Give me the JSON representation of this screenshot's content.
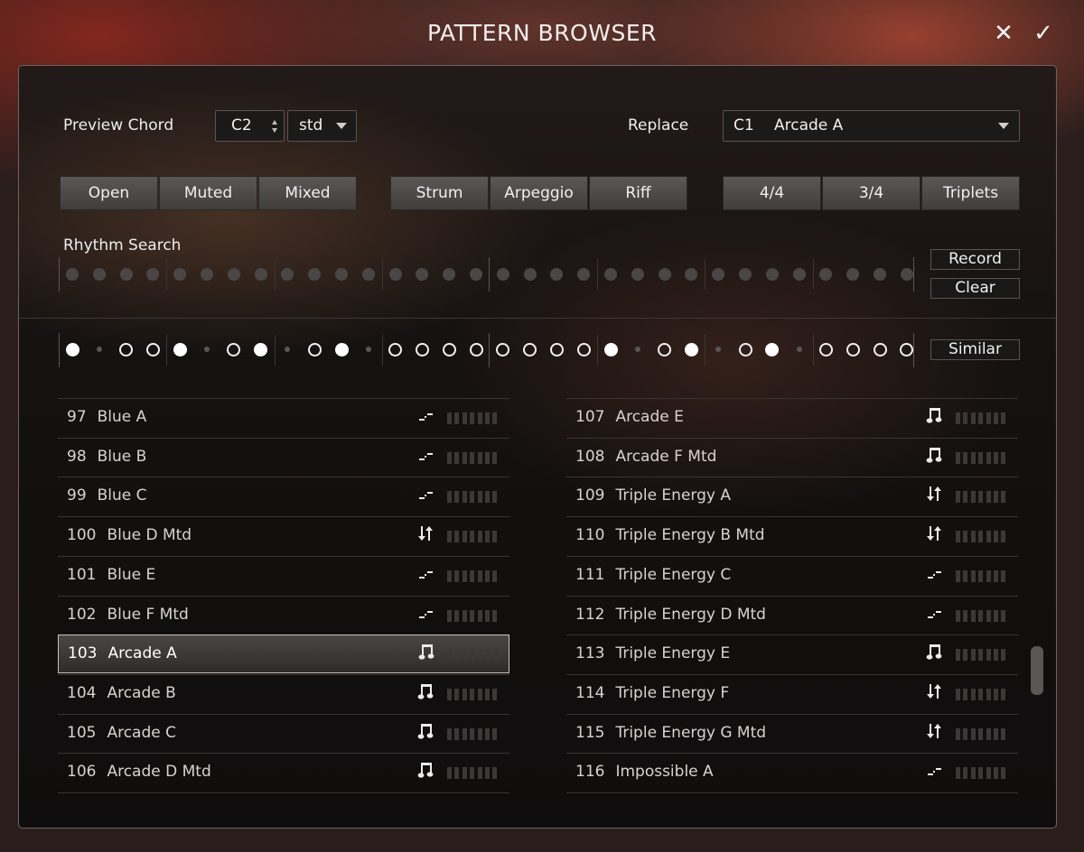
{
  "window": {
    "title": "PATTERN BROWSER",
    "close_glyph": "✕",
    "confirm_glyph": "✓"
  },
  "toolbar": {
    "preview_chord_label": "Preview Chord",
    "chord_value": "C2",
    "voicing_value": "std",
    "replace_label": "Replace",
    "replace_slot": "C1",
    "replace_value": "Arcade A",
    "style_buttons": [
      "Open",
      "Muted",
      "Mixed"
    ],
    "type_buttons": [
      "Strum",
      "Arpeggio",
      "Riff"
    ],
    "meter_buttons": [
      "4/4",
      "3/4",
      "Triplets"
    ]
  },
  "rhythm_search": {
    "label": "Rhythm Search",
    "record_label": "Record",
    "clear_label": "Clear",
    "step_count": 32
  },
  "similar": {
    "label": "Similar",
    "steps": [
      "full",
      "small",
      "open",
      "open",
      "full",
      "small",
      "open",
      "full",
      "small",
      "open",
      "full",
      "small",
      "open",
      "open",
      "open",
      "open",
      "open",
      "open",
      "open",
      "open",
      "full",
      "small",
      "open",
      "full",
      "small",
      "open",
      "full",
      "small",
      "open",
      "open",
      "open",
      "open"
    ]
  },
  "patterns_left": [
    {
      "num": "97",
      "name": "Blue A",
      "icon": "strum-icon"
    },
    {
      "num": "98",
      "name": "Blue B",
      "icon": "strum-icon"
    },
    {
      "num": "99",
      "name": "Blue C",
      "icon": "strum-icon"
    },
    {
      "num": "100",
      "name": "Blue D Mtd",
      "icon": "updown-icon"
    },
    {
      "num": "101",
      "name": "Blue E",
      "icon": "strum-icon"
    },
    {
      "num": "102",
      "name": "Blue F Mtd",
      "icon": "strum-icon"
    },
    {
      "num": "103",
      "name": "Arcade A",
      "icon": "note-icon",
      "selected": true
    },
    {
      "num": "104",
      "name": "Arcade B",
      "icon": "note-icon"
    },
    {
      "num": "105",
      "name": "Arcade C",
      "icon": "note-icon"
    },
    {
      "num": "106",
      "name": "Arcade D Mtd",
      "icon": "note-icon"
    }
  ],
  "patterns_right": [
    {
      "num": "107",
      "name": "Arcade E",
      "icon": "note-icon"
    },
    {
      "num": "108",
      "name": "Arcade F Mtd",
      "icon": "note-icon"
    },
    {
      "num": "109",
      "name": "Triple Energy A",
      "icon": "updown-icon"
    },
    {
      "num": "110",
      "name": "Triple Energy B Mtd",
      "icon": "updown-icon"
    },
    {
      "num": "111",
      "name": "Triple Energy C",
      "icon": "strum-icon"
    },
    {
      "num": "112",
      "name": "Triple Energy D Mtd",
      "icon": "strum-icon"
    },
    {
      "num": "113",
      "name": "Triple Energy E",
      "icon": "note-icon"
    },
    {
      "num": "114",
      "name": "Triple Energy F",
      "icon": "updown-icon"
    },
    {
      "num": "115",
      "name": "Triple Energy G Mtd",
      "icon": "updown-icon"
    },
    {
      "num": "116",
      "name": "Impossible A",
      "icon": "strum-icon"
    }
  ],
  "colors": {
    "accent": "#ffffff",
    "button_top": "#5a5755",
    "button_bottom": "#403e3d",
    "panel": "#141110"
  }
}
